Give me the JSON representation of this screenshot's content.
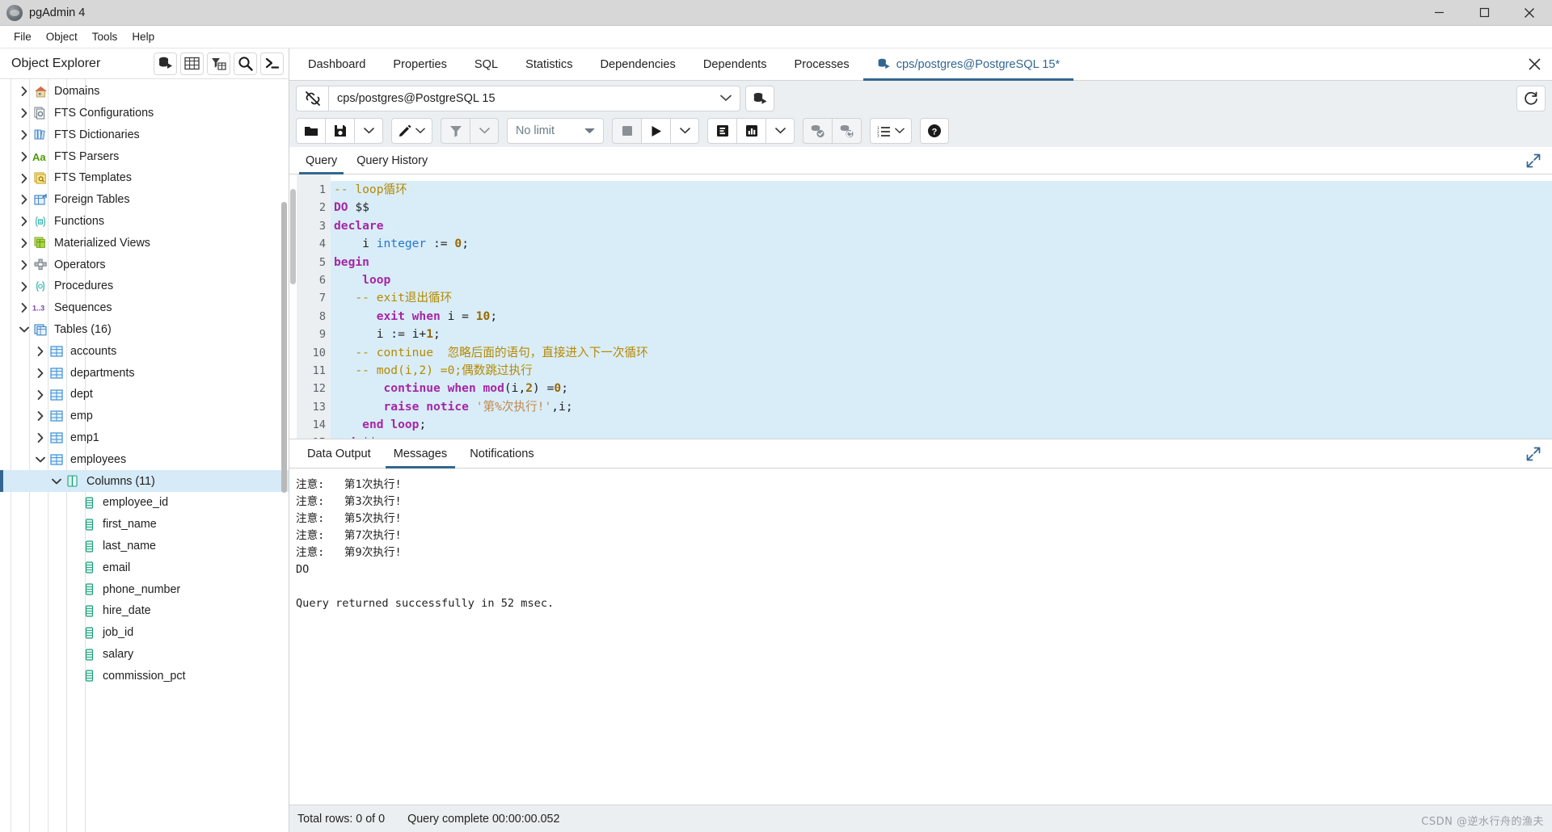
{
  "window": {
    "title": "pgAdmin 4",
    "app_icon": "pgadmin-logo-icon",
    "minimize_label": "Minimize",
    "maximize_label": "Maximize",
    "close_label": "Close"
  },
  "menubar": {
    "items": [
      {
        "label": "File",
        "name": "menu-file"
      },
      {
        "label": "Object",
        "name": "menu-object"
      },
      {
        "label": "Tools",
        "name": "menu-tools"
      },
      {
        "label": "Help",
        "name": "menu-help"
      }
    ]
  },
  "object_explorer": {
    "title": "Object Explorer",
    "tools": [
      {
        "name": "add-server-icon",
        "tooltip": "Add server"
      },
      {
        "name": "table-grid-icon",
        "tooltip": "View data"
      },
      {
        "name": "filter-table-icon",
        "tooltip": "Filtered rows"
      },
      {
        "name": "search-icon",
        "tooltip": "Search objects"
      },
      {
        "name": "terminal-icon",
        "tooltip": "PSQL tool"
      }
    ],
    "tree": [
      {
        "label": "Domains",
        "icon": "domain-icon",
        "indent": 1,
        "state": "collapsed"
      },
      {
        "label": "FTS Configurations",
        "icon": "fts-configuration-icon",
        "indent": 1,
        "state": "collapsed"
      },
      {
        "label": "FTS Dictionaries",
        "icon": "fts-dictionary-icon",
        "indent": 1,
        "state": "collapsed"
      },
      {
        "label": "FTS Parsers",
        "icon": "fts-parser-icon",
        "indent": 1,
        "state": "collapsed"
      },
      {
        "label": "FTS Templates",
        "icon": "fts-template-icon",
        "indent": 1,
        "state": "collapsed"
      },
      {
        "label": "Foreign Tables",
        "icon": "foreign-table-icon",
        "indent": 1,
        "state": "collapsed"
      },
      {
        "label": "Functions",
        "icon": "function-icon",
        "indent": 1,
        "state": "collapsed"
      },
      {
        "label": "Materialized Views",
        "icon": "materialized-view-icon",
        "indent": 1,
        "state": "collapsed"
      },
      {
        "label": "Operators",
        "icon": "operator-icon",
        "indent": 1,
        "state": "collapsed"
      },
      {
        "label": "Procedures",
        "icon": "procedure-icon",
        "indent": 1,
        "state": "collapsed"
      },
      {
        "label": "Sequences",
        "icon": "sequence-icon",
        "indent": 1,
        "state": "collapsed"
      },
      {
        "label": "Tables (16)",
        "icon": "tables-icon",
        "indent": 1,
        "state": "expanded"
      },
      {
        "label": "accounts",
        "icon": "table-icon",
        "indent": 2,
        "state": "collapsed"
      },
      {
        "label": "departments",
        "icon": "table-icon",
        "indent": 2,
        "state": "collapsed"
      },
      {
        "label": "dept",
        "icon": "table-icon",
        "indent": 2,
        "state": "collapsed"
      },
      {
        "label": "emp",
        "icon": "table-icon",
        "indent": 2,
        "state": "collapsed"
      },
      {
        "label": "emp1",
        "icon": "table-icon",
        "indent": 2,
        "state": "collapsed"
      },
      {
        "label": "employees",
        "icon": "table-icon",
        "indent": 2,
        "state": "expanded"
      },
      {
        "label": "Columns (11)",
        "icon": "columns-icon",
        "indent": 3,
        "state": "expanded",
        "selected": true
      },
      {
        "label": "employee_id",
        "icon": "column-icon",
        "indent": 4,
        "state": "leaf"
      },
      {
        "label": "first_name",
        "icon": "column-icon",
        "indent": 4,
        "state": "leaf"
      },
      {
        "label": "last_name",
        "icon": "column-icon",
        "indent": 4,
        "state": "leaf"
      },
      {
        "label": "email",
        "icon": "column-icon",
        "indent": 4,
        "state": "leaf"
      },
      {
        "label": "phone_number",
        "icon": "column-icon",
        "indent": 4,
        "state": "leaf"
      },
      {
        "label": "hire_date",
        "icon": "column-icon",
        "indent": 4,
        "state": "leaf"
      },
      {
        "label": "job_id",
        "icon": "column-icon",
        "indent": 4,
        "state": "leaf"
      },
      {
        "label": "salary",
        "icon": "column-icon",
        "indent": 4,
        "state": "leaf"
      },
      {
        "label": "commission_pct",
        "icon": "column-icon",
        "indent": 4,
        "state": "leaf"
      }
    ]
  },
  "object_tabs": {
    "items": [
      {
        "label": "Dashboard",
        "name": "tab-dashboard",
        "active": false
      },
      {
        "label": "Properties",
        "name": "tab-properties",
        "active": false
      },
      {
        "label": "SQL",
        "name": "tab-sql",
        "active": false
      },
      {
        "label": "Statistics",
        "name": "tab-statistics",
        "active": false
      },
      {
        "label": "Dependencies",
        "name": "tab-dependencies",
        "active": false
      },
      {
        "label": "Dependents",
        "name": "tab-dependents",
        "active": false
      },
      {
        "label": "Processes",
        "name": "tab-processes",
        "active": false
      },
      {
        "label": "cps/postgres@PostgreSQL 15*",
        "name": "tab-query-tool",
        "active": true,
        "icon": "database-connection-icon"
      }
    ],
    "close_icon": "close-icon"
  },
  "query_toolbar": {
    "connection_icon": "disconnected-plug-icon",
    "connection_value": "cps/postgres@PostgreSQL 15",
    "connection_caret": "chevron-down-icon",
    "connection_manage_icon": "database-connect-icon",
    "reset_icon": "reset-layout-icon",
    "buttons": [
      {
        "name": "open-file-button",
        "icon": "folder-icon"
      },
      {
        "name": "save-file-button",
        "icon": "floppy-disk-icon"
      },
      {
        "name": "save-options-button",
        "icon": "chevron-down-icon"
      },
      {
        "name": "edit-button",
        "icon": "pencil-icon"
      },
      {
        "name": "edit-options-button",
        "icon": "chevron-down-icon"
      },
      {
        "name": "filter-button",
        "icon": "funnel-icon"
      },
      {
        "name": "filter-options-button",
        "icon": "chevron-down-icon"
      },
      {
        "name": "stop-button",
        "icon": "stop-square-icon"
      },
      {
        "name": "execute-button",
        "icon": "play-triangle-icon"
      },
      {
        "name": "execute-options-button",
        "icon": "chevron-down-icon"
      },
      {
        "name": "explain-button",
        "icon": "explain-e-icon"
      },
      {
        "name": "explain-analyze-button",
        "icon": "explain-chart-icon"
      },
      {
        "name": "explain-options-button",
        "icon": "chevron-down-icon"
      },
      {
        "name": "commit-button",
        "icon": "database-commit-icon"
      },
      {
        "name": "rollback-button",
        "icon": "database-rollback-icon"
      },
      {
        "name": "macros-button",
        "icon": "list-numbered-icon"
      },
      {
        "name": "macros-caret-button",
        "icon": "chevron-down-icon"
      },
      {
        "name": "help-button",
        "icon": "question-circle-icon"
      }
    ],
    "row_limit_value": "No limit",
    "row_limit_caret": "chevron-down-icon"
  },
  "query_tabs": {
    "items": [
      {
        "label": "Query",
        "name": "tab-query",
        "active": true
      },
      {
        "label": "Query History",
        "name": "tab-query-history",
        "active": false
      }
    ],
    "expand_icon": "expand-diagonal-icon"
  },
  "editor": {
    "lines": [
      {
        "n": 1,
        "fold": false,
        "highlighted": true,
        "tokens": [
          {
            "t": "-- loop循环",
            "c": "com"
          }
        ]
      },
      {
        "n": 2,
        "fold": false,
        "highlighted": true,
        "tokens": [
          {
            "t": "DO",
            "c": "kw"
          },
          {
            "t": " $$",
            "c": "pl"
          }
        ]
      },
      {
        "n": 3,
        "fold": false,
        "highlighted": true,
        "tokens": [
          {
            "t": "declare",
            "c": "kw"
          }
        ]
      },
      {
        "n": 4,
        "fold": false,
        "highlighted": true,
        "tokens": [
          {
            "t": "    i ",
            "c": "pl"
          },
          {
            "t": "integer",
            "c": "type"
          },
          {
            "t": " := ",
            "c": "pl"
          },
          {
            "t": "0",
            "c": "num"
          },
          {
            "t": ";",
            "c": "pl"
          }
        ]
      },
      {
        "n": 5,
        "fold": false,
        "highlighted": true,
        "tokens": [
          {
            "t": "begin",
            "c": "kw"
          }
        ]
      },
      {
        "n": 6,
        "fold": true,
        "highlighted": true,
        "tokens": [
          {
            "t": "    ",
            "c": "pl"
          },
          {
            "t": "loop",
            "c": "kw"
          }
        ]
      },
      {
        "n": 7,
        "fold": false,
        "highlighted": true,
        "tokens": [
          {
            "t": "   -- exit退出循环",
            "c": "com"
          }
        ]
      },
      {
        "n": 8,
        "fold": false,
        "highlighted": true,
        "tokens": [
          {
            "t": "      ",
            "c": "pl"
          },
          {
            "t": "exit when",
            "c": "kw"
          },
          {
            "t": " i = ",
            "c": "pl"
          },
          {
            "t": "10",
            "c": "num"
          },
          {
            "t": ";",
            "c": "pl"
          }
        ]
      },
      {
        "n": 9,
        "fold": false,
        "highlighted": true,
        "tokens": [
          {
            "t": "      i := i+",
            "c": "pl"
          },
          {
            "t": "1",
            "c": "num"
          },
          {
            "t": ";",
            "c": "pl"
          }
        ]
      },
      {
        "n": 10,
        "fold": false,
        "highlighted": true,
        "tokens": [
          {
            "t": "   -- continue  忽略后面的语句，直接进入下一次循环",
            "c": "com"
          }
        ]
      },
      {
        "n": 11,
        "fold": false,
        "highlighted": true,
        "tokens": [
          {
            "t": "   -- mod(i,2) =0;偶数跳过执行",
            "c": "com"
          }
        ]
      },
      {
        "n": 12,
        "fold": false,
        "highlighted": true,
        "tokens": [
          {
            "t": "       ",
            "c": "pl"
          },
          {
            "t": "continue when mod",
            "c": "kw"
          },
          {
            "t": "(i,",
            "c": "pl"
          },
          {
            "t": "2",
            "c": "num"
          },
          {
            "t": ") =",
            "c": "pl"
          },
          {
            "t": "0",
            "c": "num"
          },
          {
            "t": ";",
            "c": "pl"
          }
        ]
      },
      {
        "n": 13,
        "fold": false,
        "highlighted": true,
        "tokens": [
          {
            "t": "       ",
            "c": "pl"
          },
          {
            "t": "raise notice",
            "c": "kw"
          },
          {
            "t": " '第%次执行!'",
            "c": "str"
          },
          {
            "t": ",i;",
            "c": "pl"
          }
        ]
      },
      {
        "n": 14,
        "fold": false,
        "highlighted": true,
        "tokens": [
          {
            "t": "    ",
            "c": "pl"
          },
          {
            "t": "end loop",
            "c": "kw"
          },
          {
            "t": ";",
            "c": "pl"
          }
        ]
      },
      {
        "n": 15,
        "fold": false,
        "highlighted": true,
        "tokens": [
          {
            "t": "end",
            "c": "kw"
          },
          {
            "t": " $$;",
            "c": "pl"
          }
        ]
      }
    ]
  },
  "output_tabs": {
    "items": [
      {
        "label": "Data Output",
        "name": "tab-data-output",
        "active": false
      },
      {
        "label": "Messages",
        "name": "tab-messages",
        "active": true
      },
      {
        "label": "Notifications",
        "name": "tab-notifications",
        "active": false
      }
    ],
    "expand_icon": "expand-diagonal-icon"
  },
  "messages": {
    "text": "注意:   第1次执行!\n注意:   第3次执行!\n注意:   第5次执行!\n注意:   第7次执行!\n注意:   第9次执行!\nDO\n\nQuery returned successfully in 52 msec."
  },
  "statusbar": {
    "total_rows": "Total rows: 0 of 0",
    "query_complete": "Query complete 00:00:00.052",
    "watermark": "CSDN @逆水行舟的渔夫"
  },
  "colors": {
    "accent": "#336791",
    "selection": "#d6eaf8",
    "code_selection": "#d9edf9",
    "toolbar_bg": "#eceff1",
    "titlebar_bg": "#d7d7d7"
  }
}
